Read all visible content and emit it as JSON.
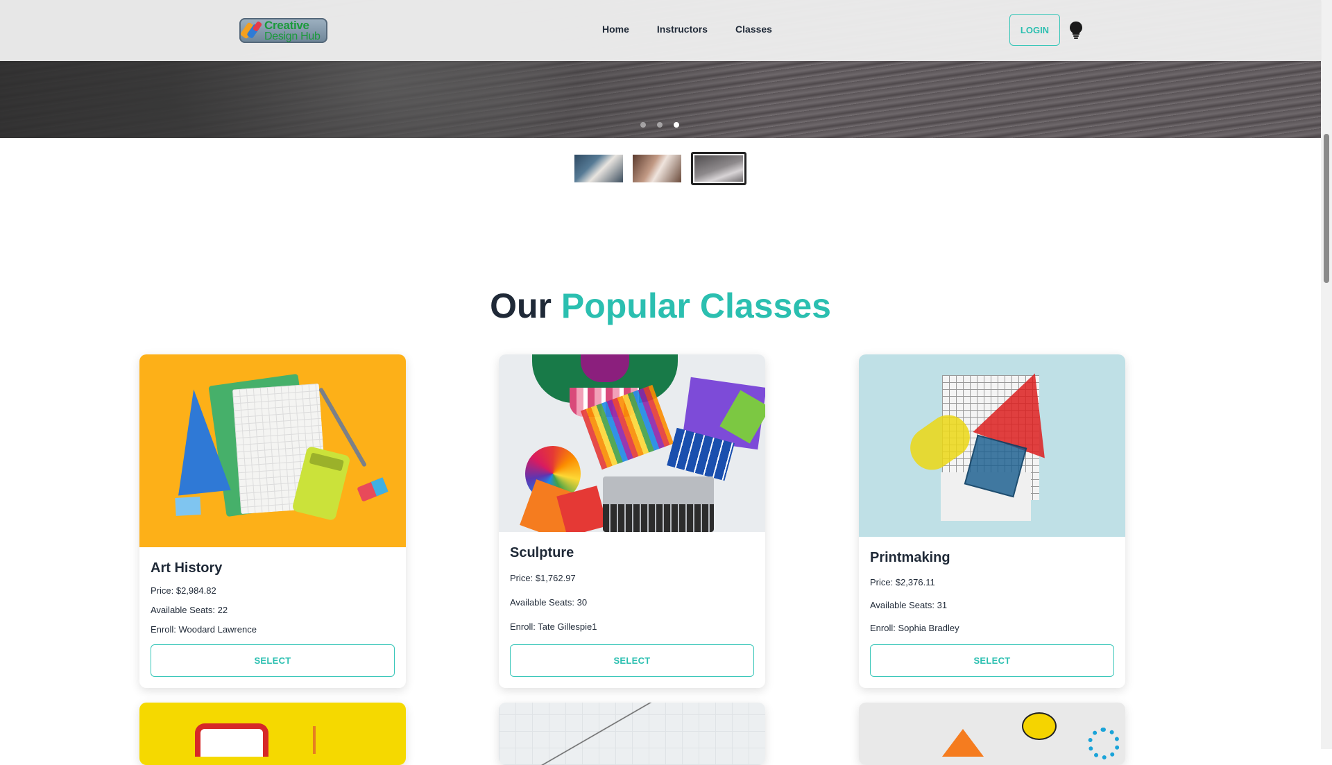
{
  "brand": {
    "logo_line1": "Creative",
    "logo_line2": "Design Hub"
  },
  "nav": {
    "links": [
      "Home",
      "Instructors",
      "Classes"
    ],
    "login_label": "LOGIN",
    "theme_icon": "lightbulb-icon"
  },
  "carousel": {
    "slide_count": 3,
    "active_index": 2
  },
  "section": {
    "title_plain": "Our",
    "title_accent": "Popular Classes"
  },
  "classes": [
    {
      "name": "Art History",
      "price": "Price: $2,984.82",
      "seats": "Available Seats: 22",
      "enroll": "Enroll: Woodard Lawrence",
      "button": "SELECT"
    },
    {
      "name": "Sculpture",
      "price": "Price: $1,762.97",
      "seats": "Available Seats: 30",
      "enroll": "Enroll: Tate Gillespie1",
      "button": "SELECT"
    },
    {
      "name": "Printmaking",
      "price": "Price: $2,376.11",
      "seats": "Available Seats: 31",
      "enroll": "Enroll: Sophia Bradley",
      "button": "SELECT"
    }
  ],
  "colors": {
    "accent": "#2bbfb0",
    "text": "#1f2937",
    "navbar": "#eeeeee"
  }
}
